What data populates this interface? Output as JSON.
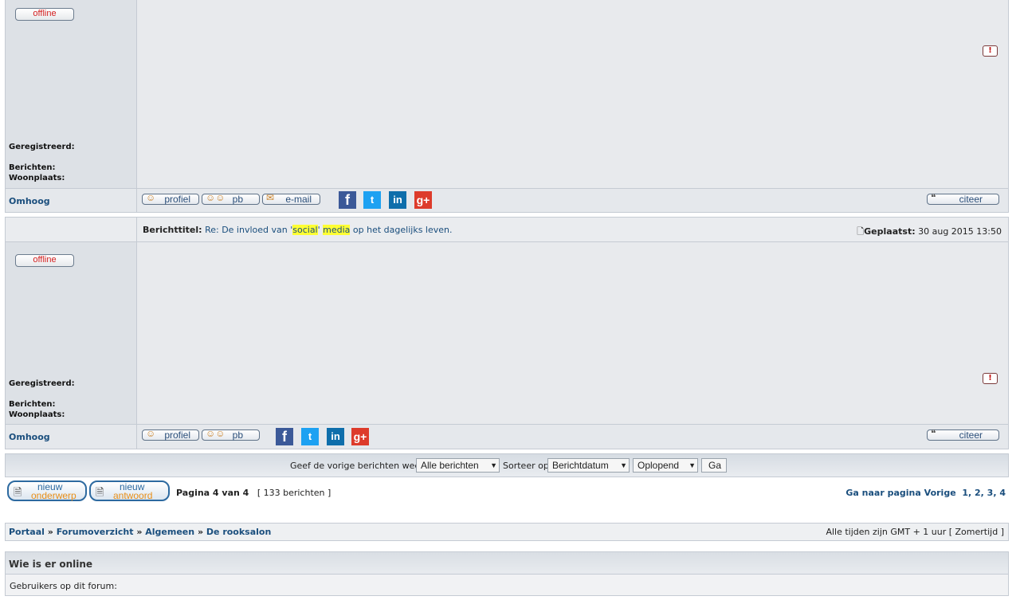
{
  "post1": {
    "status": "offline",
    "labels": {
      "registered": "Geregistreerd:",
      "posts": "Berichten:",
      "location": "Woonplaats:"
    },
    "report_icon": "!",
    "omhoog": "Omhoog",
    "buttons": {
      "profile": "profiel",
      "pm": "pb",
      "email": "e-mail",
      "quote": "citeer"
    }
  },
  "post2": {
    "subject_label": "Berichttitel:",
    "subject_prefix": "Re: De invloed van '",
    "subject_word1": "social",
    "subject_mid": "' ",
    "subject_word2": "media",
    "subject_suffix": " op het dagelijks leven.",
    "posted_label": "Geplaatst:",
    "posted_date": "30 aug 2015 13:50",
    "status": "offline",
    "labels": {
      "registered": "Geregistreerd:",
      "posts": "Berichten:",
      "location": "Woonplaats:"
    },
    "report_icon": "!",
    "omhoog": "Omhoog",
    "buttons": {
      "profile": "profiel",
      "pm": "pb",
      "quote": "citeer"
    }
  },
  "social": {
    "fb": "f",
    "tw": "t",
    "li": "in",
    "gp": "g+"
  },
  "filter": {
    "show_label": "Geef de vorige berichten weer:",
    "show_value": "Alle berichten",
    "sort_label": "Sorteer op",
    "sort_value": "Berichtdatum",
    "order_value": "Oplopend",
    "go": "Ga"
  },
  "pagination": {
    "new_topic_line1": "nieuw",
    "new_topic_line2": "onderwerp",
    "reply_line1": "nieuw",
    "reply_line2": "antwoord",
    "page_info": "Pagina 4 van 4",
    "count": "[ 133 berichten ]",
    "goto_label": "Ga naar pagina",
    "prev": "Vorige",
    "pages": [
      "1",
      "2",
      "3",
      "4"
    ]
  },
  "breadcrumb": {
    "items": [
      "Portaal",
      "Forumoverzicht",
      "Algemeen",
      "De rooksalon"
    ],
    "sep": "»",
    "timezone": "Alle tijden zijn GMT + 1 uur [ Zomertijd ]"
  },
  "online": {
    "title": "Wie is er online",
    "users": "Gebruikers op dit forum:"
  }
}
